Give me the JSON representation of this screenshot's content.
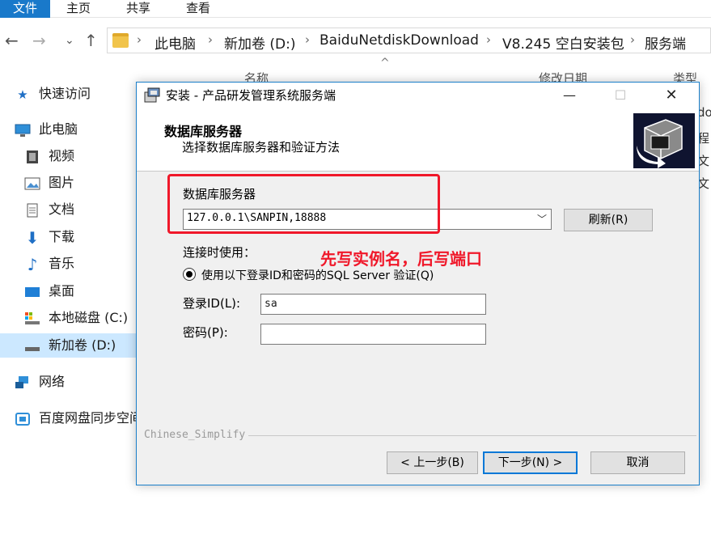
{
  "ribbon": {
    "tabs": [
      "文件",
      "主页",
      "共享",
      "查看"
    ]
  },
  "address": {
    "back": "←",
    "forward": "→",
    "recent": "⌄",
    "up": "↑",
    "crumbs": [
      "此电脑",
      "新加卷 (D:)",
      "BaiduNetdiskDownload",
      "V8.245 空白安装包",
      "服务端"
    ],
    "sep": "›"
  },
  "columns": {
    "name": "名称",
    "modified": "修改日期",
    "type": "类型"
  },
  "background_snippets": [
    "do",
    "程",
    "文",
    "文"
  ],
  "nav": {
    "items": [
      {
        "label": "快速访问",
        "icon": "star-icon"
      },
      {
        "label": "此电脑",
        "icon": "computer-icon"
      },
      {
        "label": "视频",
        "icon": "video-icon"
      },
      {
        "label": "图片",
        "icon": "picture-icon"
      },
      {
        "label": "文档",
        "icon": "document-icon"
      },
      {
        "label": "下载",
        "icon": "download-icon"
      },
      {
        "label": "音乐",
        "icon": "music-icon"
      },
      {
        "label": "桌面",
        "icon": "desktop-icon"
      },
      {
        "label": "本地磁盘 (C:)",
        "icon": "drive-icon"
      },
      {
        "label": "新加卷 (D:)",
        "icon": "drive-icon"
      },
      {
        "label": "网络",
        "icon": "network-icon"
      },
      {
        "label": "百度网盘同步空间",
        "icon": "cloud-icon"
      }
    ]
  },
  "dialog": {
    "title": "安装 - 产品研发管理系统服务端",
    "minimize": "—",
    "maximize": "☐",
    "close": "✕",
    "header_title": "数据库服务器",
    "header_subtitle": "选择数据库服务器和验证方法",
    "server_label": "数据库服务器",
    "server_value": "127.0.0.1\\SANPIN,18888",
    "refresh_label": "刷新(R)",
    "connect_label": "连接时使用：",
    "auth_option": "使用以下登录ID和密码的SQL Server 验证(Q)",
    "login_label": "登录ID(L):",
    "login_value": "sa",
    "password_label": "密码(P):",
    "password_value": "",
    "branding": "Chinese_Simplify",
    "back_button": "< 上一步(B)",
    "next_button": "下一步(N) >",
    "cancel_button": "取消"
  },
  "annotation": "先写实例名，后写端口",
  "colors": {
    "accent": "#0078d7",
    "annotation": "#f0182a",
    "ribbon_file": "#1979ca",
    "selection": "#cce8ff"
  }
}
